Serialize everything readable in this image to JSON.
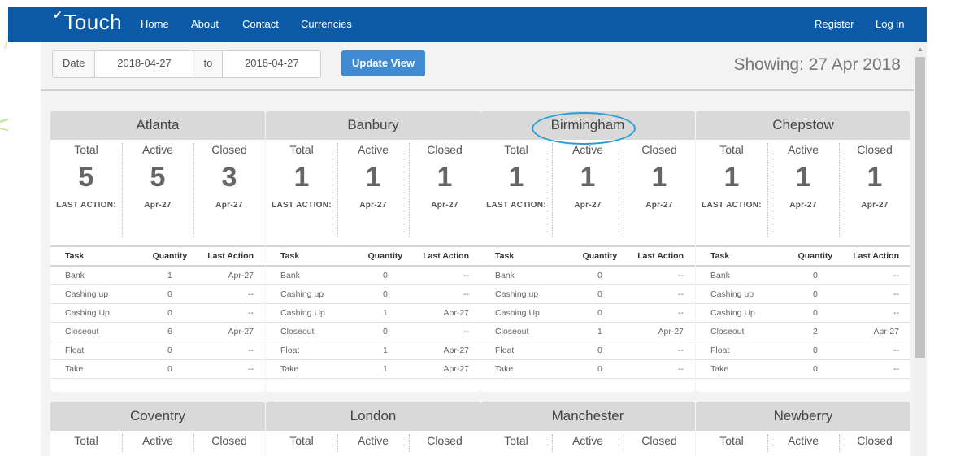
{
  "nav": {
    "brand": "Touch",
    "links": [
      "Home",
      "About",
      "Contact",
      "Currencies"
    ],
    "register": "Register",
    "login": "Log in"
  },
  "toolbar": {
    "date_label": "Date",
    "date_from": "2018-04-27",
    "to_label": "to",
    "date_to": "2018-04-27",
    "update_button": "Update View",
    "showing": "Showing: 27 Apr 2018"
  },
  "stat_labels": [
    "Total",
    "Active",
    "Closed"
  ],
  "last_action_label": "LAST ACTION:",
  "task_headers": [
    "Task",
    "Quantity",
    "Last Action"
  ],
  "locations": [
    {
      "name": "Atlanta",
      "total": "5",
      "active": "5",
      "closed": "3",
      "active_date": "Apr-27",
      "closed_date": "Apr-27",
      "tasks": [
        {
          "task": "Bank",
          "qty": "1",
          "last": "Apr-27"
        },
        {
          "task": "Cashing up",
          "qty": "0",
          "last": "--"
        },
        {
          "task": "Cashing Up",
          "qty": "0",
          "last": "--"
        },
        {
          "task": "Closeout",
          "qty": "6",
          "last": "Apr-27"
        },
        {
          "task": "Float",
          "qty": "0",
          "last": "--"
        },
        {
          "task": "Take",
          "qty": "0",
          "last": "--"
        }
      ]
    },
    {
      "name": "Banbury",
      "total": "1",
      "active": "1",
      "closed": "1",
      "active_date": "Apr-27",
      "closed_date": "Apr-27",
      "tasks": [
        {
          "task": "Bank",
          "qty": "0",
          "last": "--"
        },
        {
          "task": "Cashing up",
          "qty": "0",
          "last": "--"
        },
        {
          "task": "Cashing Up",
          "qty": "1",
          "last": "Apr-27"
        },
        {
          "task": "Closeout",
          "qty": "0",
          "last": "--"
        },
        {
          "task": "Float",
          "qty": "1",
          "last": "Apr-27"
        },
        {
          "task": "Take",
          "qty": "1",
          "last": "Apr-27"
        }
      ]
    },
    {
      "name": "Birmingham",
      "total": "1",
      "active": "1",
      "closed": "1",
      "active_date": "Apr-27",
      "closed_date": "Apr-27",
      "tasks": [
        {
          "task": "Bank",
          "qty": "0",
          "last": "--"
        },
        {
          "task": "Cashing up",
          "qty": "0",
          "last": "--"
        },
        {
          "task": "Cashing Up",
          "qty": "0",
          "last": "--"
        },
        {
          "task": "Closeout",
          "qty": "1",
          "last": "Apr-27"
        },
        {
          "task": "Float",
          "qty": "0",
          "last": "--"
        },
        {
          "task": "Take",
          "qty": "0",
          "last": "--"
        }
      ]
    },
    {
      "name": "Chepstow",
      "total": "1",
      "active": "1",
      "closed": "1",
      "active_date": "Apr-27",
      "closed_date": "Apr-27",
      "tasks": [
        {
          "task": "Bank",
          "qty": "0",
          "last": "--"
        },
        {
          "task": "Cashing up",
          "qty": "0",
          "last": "--"
        },
        {
          "task": "Cashing Up",
          "qty": "0",
          "last": "--"
        },
        {
          "task": "Closeout",
          "qty": "2",
          "last": "Apr-27"
        },
        {
          "task": "Float",
          "qty": "0",
          "last": "--"
        },
        {
          "task": "Take",
          "qty": "0",
          "last": "--"
        }
      ]
    },
    {
      "name": "Coventry",
      "tasks": []
    },
    {
      "name": "London",
      "tasks": []
    },
    {
      "name": "Manchester",
      "tasks": []
    },
    {
      "name": "Newberry",
      "tasks": []
    }
  ],
  "highlighted_location": "Birmingham",
  "colors": {
    "navbar": "#0c5aa6",
    "button": "#3f8ad1",
    "card_header": "#d9d9d9",
    "highlight": "#2a9dd6"
  }
}
